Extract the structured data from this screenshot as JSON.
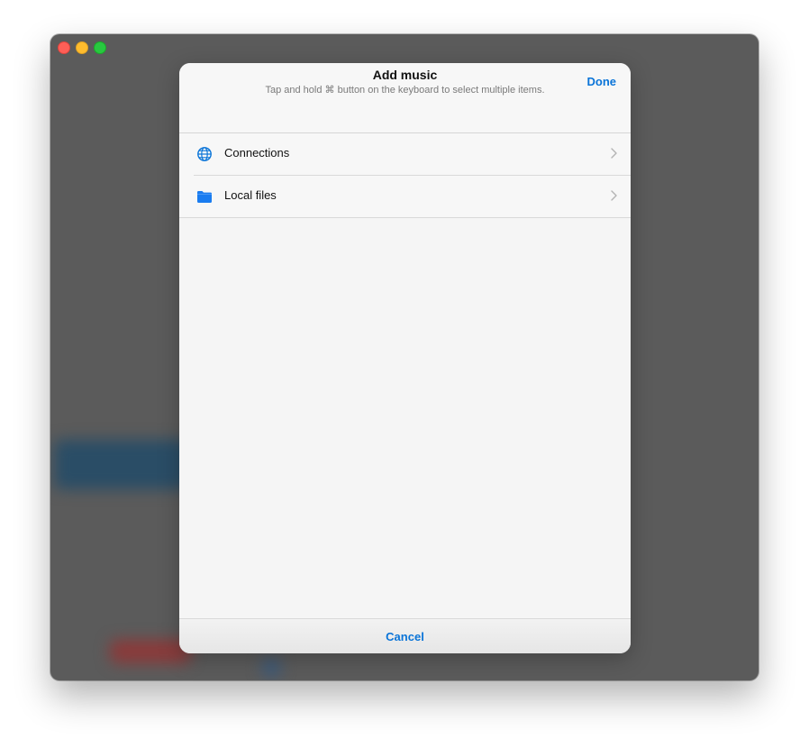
{
  "window": {
    "controls": [
      "close",
      "minimize",
      "zoom"
    ]
  },
  "sheet": {
    "title": "Add music",
    "subtitle": "Tap and hold ⌘ button on the keyboard to select multiple items.",
    "done_label": "Done",
    "cancel_label": "Cancel",
    "items": [
      {
        "label": "Connections",
        "icon": "globe-icon"
      },
      {
        "label": "Local files",
        "icon": "folder-icon"
      }
    ]
  },
  "colors": {
    "accent": "#0a74d8",
    "folder": "#1a7cf0"
  }
}
